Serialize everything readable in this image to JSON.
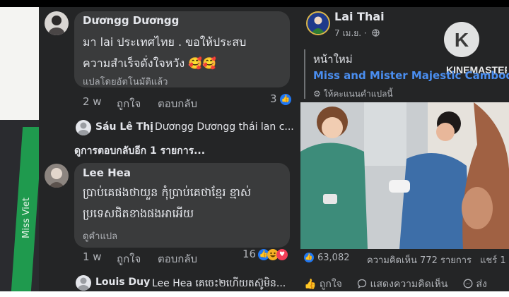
{
  "comments": [
    {
      "author": "Dươngg Dươngg",
      "text_line1": "มา lai ประเทศไทย . ขอให้ประสบ",
      "text_line2": "ความสำเร็จดั่งใจหวัง 🥰🥰",
      "translated_by": "แปลโดยอัตโนมัติแล้ว",
      "time": "2 w",
      "like_label": "ถูกใจ",
      "reply_label": "ตอบกลับ",
      "reaction_count": "3"
    },
    {
      "author": "Lee Hea",
      "text_line1": "ប្រាប់គេផងថាយួន កុំប្រាប់គេថាខ្មែរ ខ្មាស់",
      "text_line2": "ប្រទេសជិតខាងផងអាអើយ",
      "see_translation": "ดูคำแปล",
      "time": "1 w",
      "like_label": "ถูกใจ",
      "reply_label": "ตอบกลับ",
      "reaction_count": "16"
    }
  ],
  "replies": [
    {
      "author": "Sáu Lê Thị",
      "text": "Dươngg Dươngg thái lan c..."
    },
    {
      "author": "Louis Duy",
      "text": "Lee Hea គេចេះ២ហើយតស៊ូមិន..."
    }
  ],
  "more_replies_label": "ดูการตอบกลับอีก 1 รายการ...",
  "post": {
    "page_name": "Lai Thai",
    "meta": "7 เม.ย. ·",
    "heading": "หน้าใหม่",
    "link_text": "Miss and Mister Majestic Cambodia",
    "translate_hint": "ให้คะแนนคำแปลนี้",
    "reactions": "63,082",
    "comments_count": "ความคิดเห็น 772 รายการ",
    "shares": "แชร์ 1",
    "like_label": "ถูกใจ",
    "comment_label": "แสดงความคิดเห็น",
    "share_label": "ส่ง"
  },
  "watermark": {
    "letter": "K",
    "text": "KINEMASTER"
  },
  "left_photo_sash_text": "Miss Viet"
}
